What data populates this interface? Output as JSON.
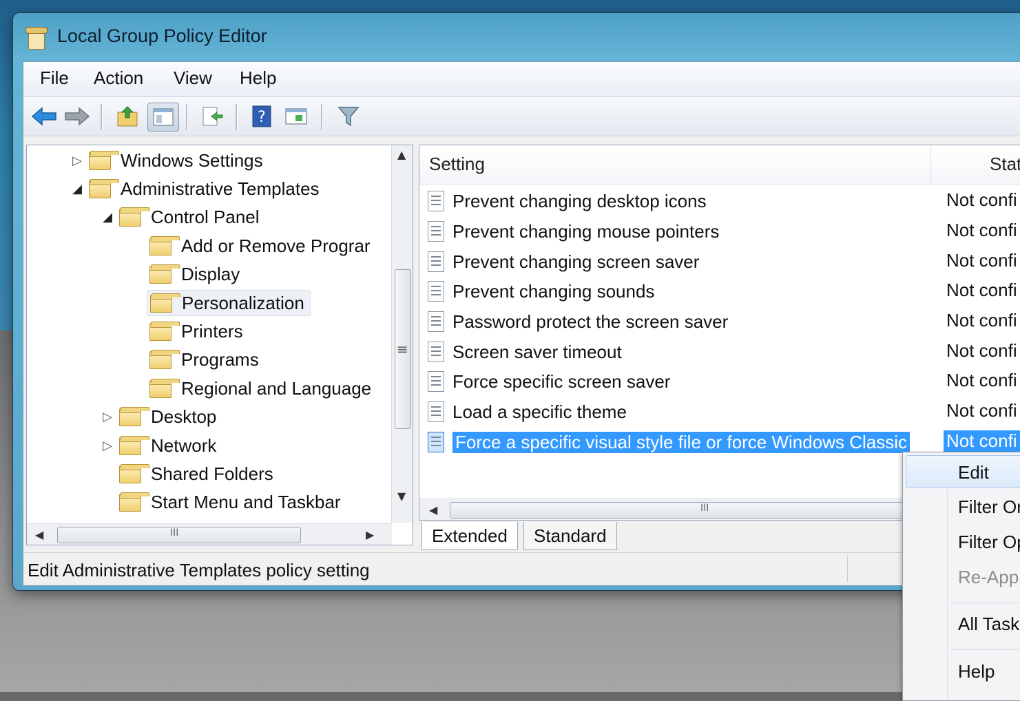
{
  "window": {
    "title": "Local Group Policy Editor"
  },
  "menu": [
    "File",
    "Action",
    "View",
    "Help"
  ],
  "toolbar": [
    "back-icon",
    "forward-icon",
    "up-folder-icon",
    "show-hide-tree-icon",
    "export-list-icon",
    "help-icon",
    "properties-icon",
    "filter-icon"
  ],
  "tree": [
    {
      "label": "Windows Settings",
      "expander": "▷"
    },
    {
      "label": "Administrative Templates",
      "expander": "◢"
    },
    {
      "label": "Control Panel",
      "expander": "◢"
    },
    {
      "label": "Add or Remove Prograr",
      "expander": ""
    },
    {
      "label": "Display",
      "expander": ""
    },
    {
      "label": "Personalization",
      "expander": ""
    },
    {
      "label": "Printers",
      "expander": ""
    },
    {
      "label": "Programs",
      "expander": ""
    },
    {
      "label": "Regional and Language",
      "expander": ""
    },
    {
      "label": "Desktop",
      "expander": "▷"
    },
    {
      "label": "Network",
      "expander": "▷"
    },
    {
      "label": "Shared Folders",
      "expander": ""
    },
    {
      "label": "Start Menu and Taskbar",
      "expander": ""
    }
  ],
  "list": {
    "columns": [
      "Setting",
      "Stat"
    ],
    "rows": [
      {
        "setting": "Prevent changing desktop icons",
        "state": "Not confi"
      },
      {
        "setting": "Prevent changing mouse pointers",
        "state": "Not confi"
      },
      {
        "setting": "Prevent changing screen saver",
        "state": "Not confi"
      },
      {
        "setting": "Prevent changing sounds",
        "state": "Not confi"
      },
      {
        "setting": "Password protect the screen saver",
        "state": "Not confi"
      },
      {
        "setting": "Screen saver timeout",
        "state": "Not confi"
      },
      {
        "setting": "Force specific screen saver",
        "state": "Not confi"
      },
      {
        "setting": "Load a specific theme",
        "state": "Not confi"
      },
      {
        "setting": "Force a specific visual style file or force Windows Classic",
        "state": "Not confi"
      }
    ]
  },
  "tabs": [
    "Extended",
    "Standard"
  ],
  "status": "Edit Administrative Templates policy setting",
  "context_menu": {
    "items": [
      "Edit",
      "Filter Or",
      "Filter Op",
      "Re-App",
      "All Task",
      "Help"
    ]
  },
  "scroll_glyphs": {
    "up": "▲",
    "down": "▼",
    "left": "◀",
    "right": "▶",
    "grip_v": "≡",
    "grip_h": "III"
  }
}
